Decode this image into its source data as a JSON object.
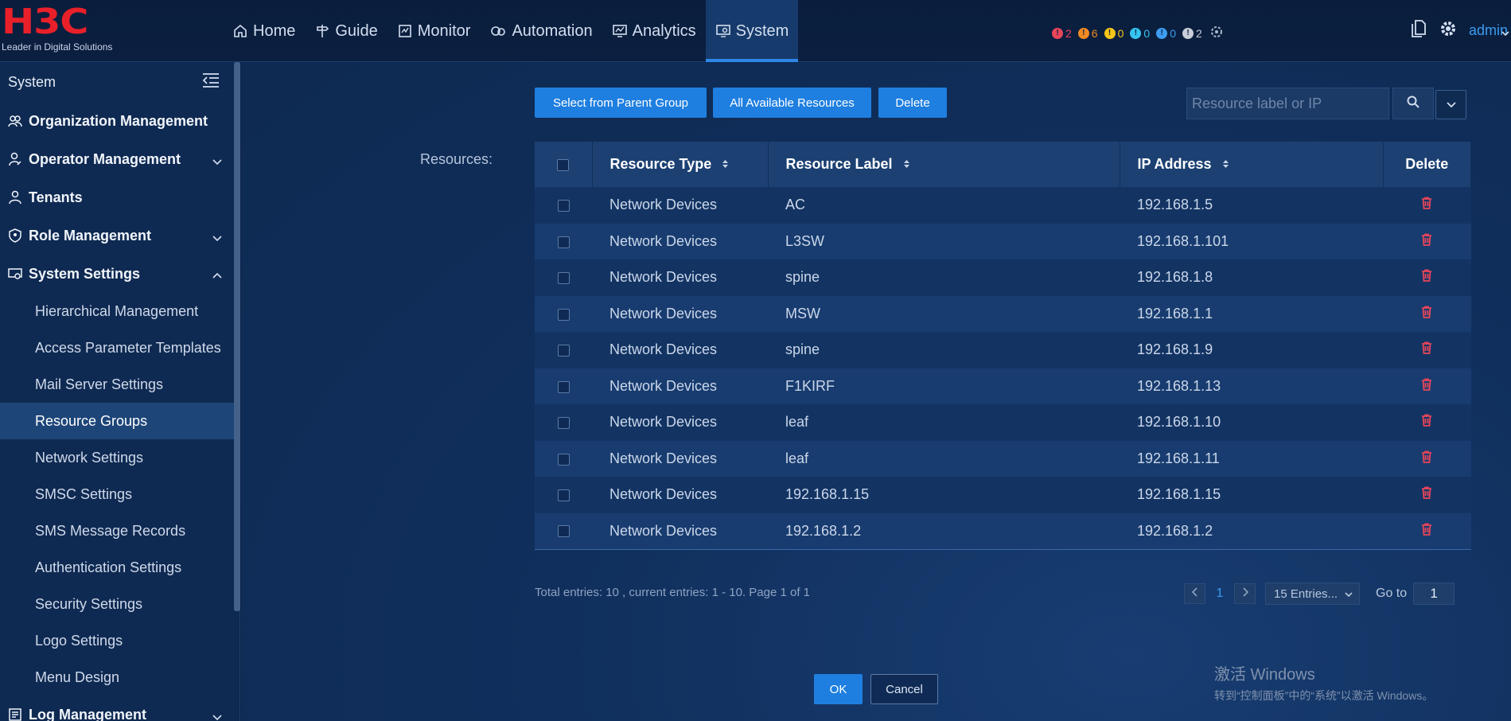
{
  "brand": {
    "logo": "H3C",
    "tagline": "Leader in Digital Solutions",
    "accent": "#e8202a"
  },
  "nav": [
    {
      "label": "Home",
      "icon": "home-icon"
    },
    {
      "label": "Guide",
      "icon": "signpost-icon"
    },
    {
      "label": "Monitor",
      "icon": "monitor-icon"
    },
    {
      "label": "Automation",
      "icon": "automation-icon"
    },
    {
      "label": "Analytics",
      "icon": "analytics-icon"
    },
    {
      "label": "System",
      "icon": "system-icon",
      "active": true
    }
  ],
  "alarms": [
    {
      "level": "critical",
      "count": "2",
      "color": "#e8455a"
    },
    {
      "level": "major",
      "count": "6",
      "color": "#f08a24"
    },
    {
      "level": "minor",
      "count": "0",
      "color": "#f5c518"
    },
    {
      "level": "warning",
      "count": "0",
      "color": "#36c3f0"
    },
    {
      "level": "info",
      "count": "0",
      "color": "#3c9cf0"
    },
    {
      "level": "unknown",
      "count": "2",
      "color": "#c8ced8"
    }
  ],
  "user": {
    "name": "admin"
  },
  "sidebar": {
    "title": "System",
    "groups": {
      "org": "Organization Management",
      "operator": "Operator Management",
      "tenants": "Tenants",
      "role": "Role Management",
      "settings": "System Settings",
      "log": "Log Management"
    },
    "items": [
      "Hierarchical Management",
      "Access Parameter Templates",
      "Mail Server Settings",
      "Resource Groups",
      "Network Settings",
      "SMSC Settings",
      "SMS Message Records",
      "Authentication Settings",
      "Security Settings",
      "Logo Settings",
      "Menu Design"
    ]
  },
  "toolbar": {
    "select_parent": "Select from Parent Group",
    "all_available": "All Available Resources",
    "delete": "Delete"
  },
  "search": {
    "placeholder": "Resource label or IP"
  },
  "resources_label": "Resources:",
  "table": {
    "headers": {
      "type": "Resource Type",
      "label": "Resource Label",
      "ip": "IP Address",
      "delete": "Delete"
    },
    "rows": [
      {
        "type": "Network Devices",
        "label": "AC",
        "ip": "192.168.1.5"
      },
      {
        "type": "Network Devices",
        "label": "L3SW",
        "ip": "192.168.1.101"
      },
      {
        "type": "Network Devices",
        "label": "spine",
        "ip": "192.168.1.8"
      },
      {
        "type": "Network Devices",
        "label": "MSW",
        "ip": "192.168.1.1"
      },
      {
        "type": "Network Devices",
        "label": "spine",
        "ip": "192.168.1.9"
      },
      {
        "type": "Network Devices",
        "label": "F1KIRF",
        "ip": "192.168.1.13"
      },
      {
        "type": "Network Devices",
        "label": "leaf",
        "ip": "192.168.1.10"
      },
      {
        "type": "Network Devices",
        "label": "leaf",
        "ip": "192.168.1.11"
      },
      {
        "type": "Network Devices",
        "label": "192.168.1.15",
        "ip": "192.168.1.15"
      },
      {
        "type": "Network Devices",
        "label": "192.168.1.2",
        "ip": "192.168.1.2"
      }
    ]
  },
  "pagination": {
    "summary": "Total entries: 10 , current entries: 1 - 10. Page 1 of 1",
    "page": "1",
    "page_size": "15 Entries...",
    "goto_label": "Go to",
    "goto_value": "1"
  },
  "dialog": {
    "ok": "OK",
    "cancel": "Cancel"
  },
  "watermark": {
    "line1": "激活 Windows",
    "line2": "转到“控制面板”中的“系统”以激活 Windows。"
  }
}
